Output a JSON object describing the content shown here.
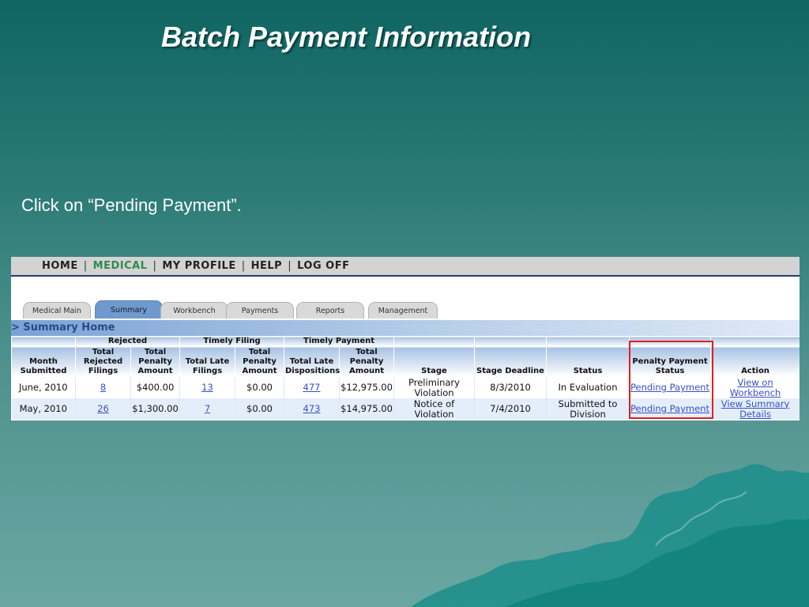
{
  "slide": {
    "title": "Batch Payment Information",
    "instruction": "Click on “Pending Payment”."
  },
  "app": {
    "top_nav": [
      {
        "label": "HOME",
        "active": false
      },
      {
        "label": "MEDICAL",
        "active": true
      },
      {
        "label": "MY PROFILE",
        "active": false
      },
      {
        "label": "HELP",
        "active": false
      },
      {
        "label": "LOG OFF",
        "active": false
      }
    ],
    "tabs": [
      {
        "label": "Medical Main",
        "active": false
      },
      {
        "label": "Summary",
        "active": true
      },
      {
        "label": "Workbench",
        "active": false
      },
      {
        "label": "Payments",
        "active": false
      },
      {
        "label": "Reports",
        "active": false
      },
      {
        "label": "Management",
        "active": false
      }
    ],
    "section_title": "> Summary Home",
    "table": {
      "group_headers": {
        "rejected": "Rejected",
        "timely_filing": "Timely Filing",
        "timely_payment": "Timely Payment"
      },
      "columns": {
        "month": "Month Submitted",
        "rejected_filings": "Total Rejected Filings",
        "rejected_penalty": "Total Penalty Amount",
        "late_filings": "Total Late Filings",
        "filing_penalty": "Total Penalty Amount",
        "late_dispositions": "Total Late Dispositions",
        "payment_penalty": "Total Penalty Amount",
        "stage": "Stage",
        "stage_deadline": "Stage Deadline",
        "status": "Status",
        "penalty_payment_status": "Penalty Payment Status",
        "action": "Action"
      },
      "rows": [
        {
          "month": "June, 2010",
          "rejected_filings": "8",
          "rejected_penalty": "$400.00",
          "late_filings": "13",
          "filing_penalty": "$0.00",
          "late_dispositions": "477",
          "payment_penalty": "$12,975.00",
          "stage": "Preliminary Violation",
          "stage_deadline": "8/3/2010",
          "status": "In Evaluation",
          "penalty_payment_status": "Pending Payment",
          "action": "View on Workbench"
        },
        {
          "month": "May, 2010",
          "rejected_filings": "26",
          "rejected_penalty": "$1,300.00",
          "late_filings": "7",
          "filing_penalty": "$0.00",
          "late_dispositions": "473",
          "payment_penalty": "$14,975.00",
          "stage": "Notice of Violation",
          "stage_deadline": "7/4/2010",
          "status": "Submitted to Division",
          "penalty_payment_status": "Pending Payment",
          "action": "View Summary Details"
        }
      ]
    }
  },
  "colors": {
    "highlight_box": "#e0201a",
    "link": "#3a4fc8",
    "active_nav": "#2e8a52",
    "active_tab": "#6f99cf"
  }
}
